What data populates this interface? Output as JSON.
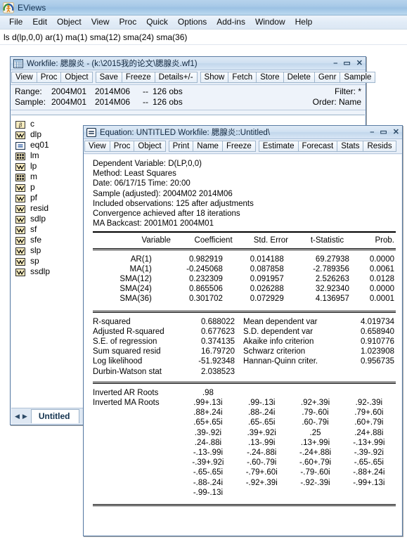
{
  "app": {
    "title": "EViews",
    "icon": "eviews-logo-icon",
    "menu": [
      "File",
      "Edit",
      "Object",
      "View",
      "Proc",
      "Quick",
      "Options",
      "Add-ins",
      "Window",
      "Help"
    ],
    "command_line": "ls d(lp,0,0)  ar(1)  ma(1) sma(12) sma(24) sma(36)"
  },
  "workfile_window": {
    "icon": "workfile-grid-icon",
    "title": "Workfile: 腮腺炎 - (k:\\2015我的论文\\腮腺炎.wf1)",
    "buttons": {
      "minimize": "–",
      "maximize": "▭",
      "close": "✕"
    },
    "toolbar_group1": [
      "View",
      "Proc",
      "Object"
    ],
    "toolbar_group2": [
      "Save",
      "Freeze",
      "Details+/-"
    ],
    "toolbar_group3": [
      "Show",
      "Fetch",
      "Store",
      "Delete",
      "Genr",
      "Sample"
    ],
    "range": {
      "label": "Range:",
      "start": "2004M01",
      "end": "2014M06",
      "dash": "--",
      "obs": "126 obs"
    },
    "sample": {
      "label": "Sample:",
      "start": "2004M01",
      "end": "2014M06",
      "dash": "--",
      "obs": "126 obs"
    },
    "filter": "Filter: *",
    "order": "Order: Name",
    "objects": [
      {
        "name": "c",
        "icon": "beta-coef-icon"
      },
      {
        "name": "dlp",
        "icon": "series-icon"
      },
      {
        "name": "eq01",
        "icon": "equation-icon"
      },
      {
        "name": "lm",
        "icon": "group-icon"
      },
      {
        "name": "lp",
        "icon": "series-icon"
      },
      {
        "name": "m",
        "icon": "group-icon"
      },
      {
        "name": "p",
        "icon": "series-icon"
      },
      {
        "name": "pf",
        "icon": "series-icon"
      },
      {
        "name": "resid",
        "icon": "series-icon"
      },
      {
        "name": "sdlp",
        "icon": "series-icon"
      },
      {
        "name": "sf",
        "icon": "series-icon"
      },
      {
        "name": "sfe",
        "icon": "series-icon"
      },
      {
        "name": "slp",
        "icon": "series-icon"
      },
      {
        "name": "sp",
        "icon": "series-icon"
      },
      {
        "name": "ssdlp",
        "icon": "series-icon"
      }
    ],
    "tab": "Untitled",
    "tab_prev": "◀",
    "tab_next": "▶"
  },
  "equation_window": {
    "icon": "equation-icon",
    "title": "Equation: UNTITLED   Workfile: 腮腺炎::Untitled\\",
    "buttons": {
      "minimize": "–",
      "maximize": "▭",
      "close": "✕"
    },
    "toolbar_group1": [
      "View",
      "Proc",
      "Object"
    ],
    "toolbar_group2": [
      "Print",
      "Name",
      "Freeze"
    ],
    "toolbar_group3": [
      "Estimate",
      "Forecast",
      "Stats",
      "Resids"
    ],
    "header_lines": [
      "Dependent Variable: D(LP,0,0)",
      "Method: Least Squares",
      "Date: 06/17/15   Time: 20:00",
      "Sample (adjusted): 2004M02 2014M06",
      "Included observations: 125 after adjustments",
      "Convergence achieved after 18 iterations",
      "MA Backcast: 2001M01 2004M01"
    ],
    "coef_headers": [
      "Variable",
      "Coefficient",
      "Std. Error",
      "t-Statistic",
      "Prob."
    ],
    "coef_rows": [
      [
        "AR(1)",
        "0.982919",
        "0.014188",
        "69.27938",
        "0.0000"
      ],
      [
        "MA(1)",
        "-0.245068",
        "0.087858",
        "-2.789356",
        "0.0061"
      ],
      [
        "SMA(12)",
        "0.232309",
        "0.091957",
        "2.526263",
        "0.0128"
      ],
      [
        "SMA(24)",
        "0.865506",
        "0.026288",
        "32.92340",
        "0.0000"
      ],
      [
        "SMA(36)",
        "0.301702",
        "0.072929",
        "4.136957",
        "0.0001"
      ]
    ],
    "stats_rows": [
      [
        "R-squared",
        "0.688022",
        "Mean dependent var",
        "4.019734"
      ],
      [
        "Adjusted R-squared",
        "0.677623",
        "S.D. dependent var",
        "0.658940"
      ],
      [
        "S.E. of regression",
        "0.374135",
        "Akaike info criterion",
        "0.910776"
      ],
      [
        "Sum squared resid",
        "16.79720",
        "Schwarz criterion",
        "1.023908"
      ],
      [
        "Log likelihood",
        "-51.92348",
        "Hannan-Quinn criter.",
        "0.956735"
      ],
      [
        "Durbin-Watson stat",
        "2.038523",
        "",
        ""
      ]
    ],
    "roots_ar_label": "Inverted AR Roots",
    "roots_ma_label": "Inverted MA Roots",
    "roots_ar": [
      ".98",
      "",
      "",
      ""
    ],
    "roots_ma": [
      [
        ".99+.13i",
        ".99-.13i",
        ".92+.39i",
        ".92-.39i"
      ],
      [
        ".88+.24i",
        ".88-.24i",
        ".79-.60i",
        ".79+.60i"
      ],
      [
        ".65+.65i",
        ".65-.65i",
        ".60-.79i",
        ".60+.79i"
      ],
      [
        ".39-.92i",
        ".39+.92i",
        ".25",
        ".24+.88i"
      ],
      [
        ".24-.88i",
        ".13-.99i",
        ".13+.99i",
        "-.13+.99i"
      ],
      [
        "-.13-.99i",
        "-.24-.88i",
        "-.24+.88i",
        "-.39-.92i"
      ],
      [
        "-.39+.92i",
        "-.60-.79i",
        "-.60+.79i",
        "-.65-.65i"
      ],
      [
        "-.65-.65i",
        "-.79+.60i",
        "-.79-.60i",
        "-.88+.24i"
      ],
      [
        "-.88-.24i",
        "-.92+.39i",
        "-.92-.39i",
        "-.99+.13i"
      ],
      [
        "-.99-.13i",
        "",
        "",
        ""
      ]
    ]
  },
  "colors": {
    "titlebar_blue": "#a9cae8",
    "window_chrome": "#eef3fa",
    "window_border": "#5a7ca3",
    "series_icon_fill": "#f7ecc0",
    "content_bg": "#ffffff"
  }
}
